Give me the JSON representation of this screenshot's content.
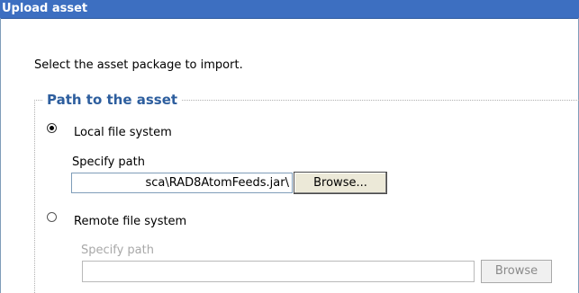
{
  "window": {
    "title": "Upload asset"
  },
  "instruction": "Select the asset package to import.",
  "group": {
    "title": "Path to the asset"
  },
  "local": {
    "label": "Local file system",
    "selected": true,
    "specify_label": "Specify path",
    "path_value": "\\sca\\RAD8AtomFeeds.jar",
    "browse_label": "Browse..."
  },
  "remote": {
    "label": "Remote file system",
    "selected": false,
    "specify_label": "Specify path",
    "path_value": "",
    "browse_label": "Browse"
  },
  "colors": {
    "titlebar": "#3d6fc1",
    "group_title": "#2d5e9e",
    "disabled_text": "#a8a8a8"
  }
}
